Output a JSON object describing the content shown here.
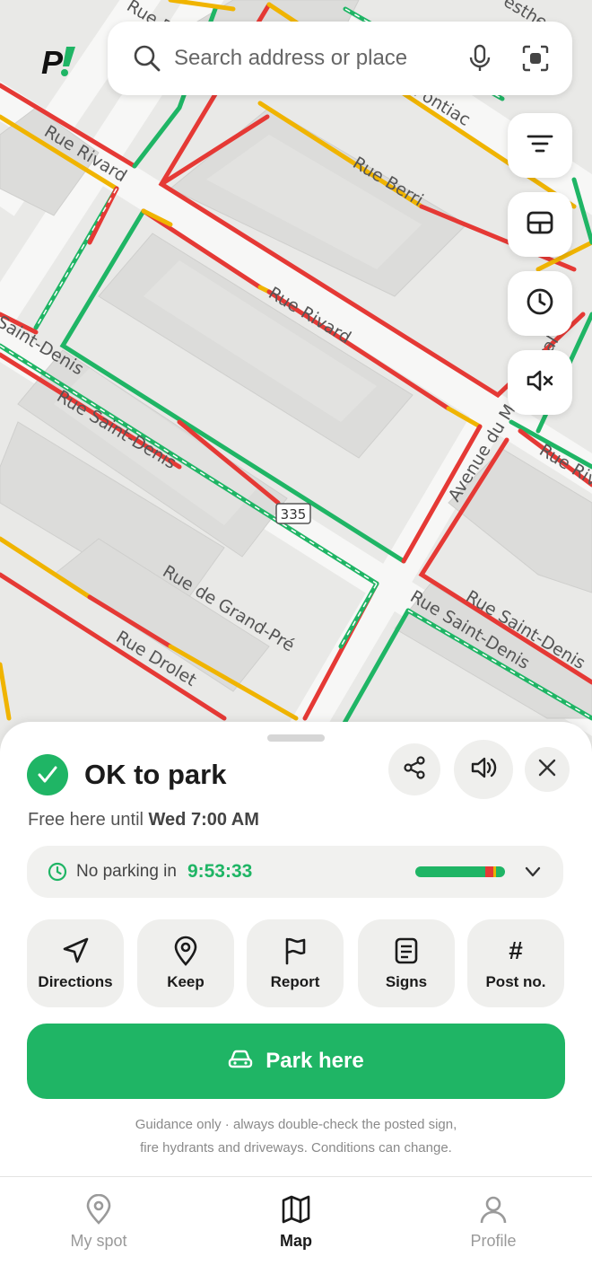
{
  "app": {
    "logo_text": "P!"
  },
  "search": {
    "placeholder": "Search address or place"
  },
  "map_controls": [
    "filter-icon",
    "layers-icon",
    "clock-icon",
    "mute-icon"
  ],
  "map": {
    "streets": [
      "Rue Berri",
      "Pontiac",
      "Rue Rivard",
      "Rue Berri",
      "Rue Rivard",
      "Saint-Denis",
      "Rue Saint-Denis",
      "Avenue du Mont-Royal",
      "Rue Riv",
      "Rue de Grand-Pré",
      "Rue Drolet",
      "Rue Saint-Denis",
      "Rue Saint-Denis",
      "esthe"
    ],
    "badge": "335",
    "colors": {
      "allowed": "#1fb565",
      "no_parking": "#e53935",
      "restricted": "#f0b400"
    }
  },
  "status": {
    "title": "OK to park",
    "subtitle_prefix": "Free here until",
    "subtitle_time": "Wed 7:00 AM",
    "color": "#1fb565"
  },
  "timer": {
    "label": "No parking in",
    "value": "9:53:33",
    "progress": {
      "allowed_fraction": 0.78,
      "restricted_fraction": 0.18
    }
  },
  "actions": [
    {
      "label": "Directions",
      "icon": "navigation-arrow-icon"
    },
    {
      "label": "Keep",
      "icon": "pin-icon"
    },
    {
      "label": "Report",
      "icon": "flag-icon"
    },
    {
      "label": "Signs",
      "icon": "document-icon"
    },
    {
      "label": "Post no.",
      "icon": "hash-icon",
      "glyph": "#"
    }
  ],
  "park_button": {
    "label": "Park here",
    "icon": "car-icon"
  },
  "disclaimer": {
    "line1": "Guidance only · always double-check the posted sign,",
    "line2": "fire hydrants and driveways. Conditions can change."
  },
  "tabs": [
    {
      "label": "My spot",
      "icon": "location-pin-icon",
      "active": false
    },
    {
      "label": "Map",
      "icon": "map-icon",
      "active": true
    },
    {
      "label": "Profile",
      "icon": "user-icon",
      "active": false
    }
  ]
}
